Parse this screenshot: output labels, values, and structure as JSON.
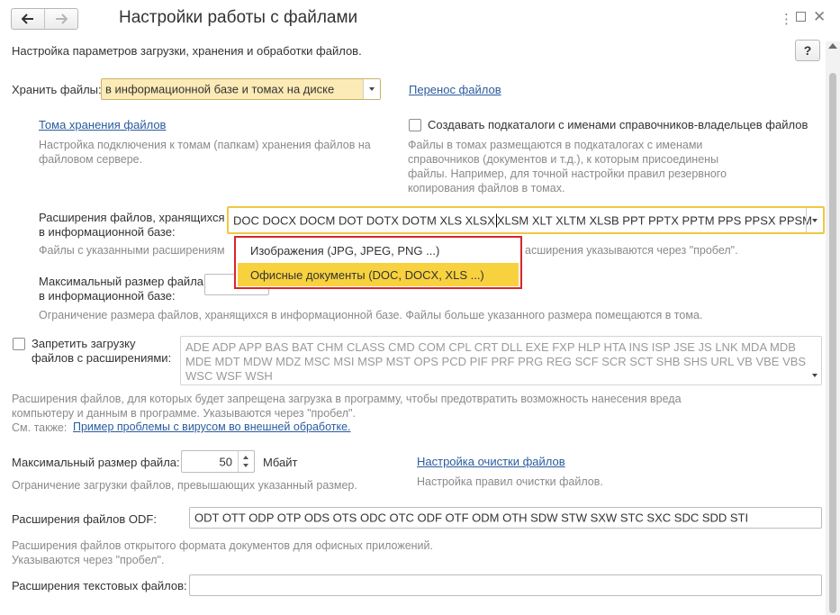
{
  "window": {
    "title": "Настройки работы с файлами",
    "subtitle": "Настройка параметров загрузки, хранения и обработки файлов.",
    "help_label": "?",
    "back_icon": "arrow-left-icon",
    "forward_icon": "arrow-right-icon",
    "menu_icon": "more-icon",
    "maximize_icon": "maximize-icon",
    "close_icon": "close-icon"
  },
  "storage": {
    "label": "Хранить файлы:",
    "value": "в информационной базе и томах на диске",
    "transfer_link": "Перенос файлов",
    "volumes_link": "Тома хранения файлов",
    "volumes_hint": "Настройка подключения к томам (папкам) хранения файлов на файловом сервере.",
    "subfolders_label": "Создавать подкаталоги с именами справочников-владельцев файлов",
    "subfolders_hint": "Файлы в томах размещаются в подкаталогах с именами справочников (документов и т.д.), к которым присоединены файлы. Например, для точной настройки правил резервного копирования файлов в томах."
  },
  "ib_extensions": {
    "label_line1": "Расширения файлов, хранящихся",
    "label_line2": "в информационной базе:",
    "value_before_cursor": "DOC DOCX DOCM DOT DOTX DOTM XLS XLSX",
    "value_after_cursor": "XLSM XLT XLTM XLSB PPT PPTX PPTM PPS PPSX PPSM",
    "hint_left": "Файлы с указанными расширениям",
    "hint_right": "асширения указываются через \"пробел\".",
    "dropdown_items": [
      "Изображения (JPG, JPEG, PNG ...)",
      "Офисные документы (DOC, DOCX, XLS ...)"
    ],
    "selected_index": 1
  },
  "ib_max_size": {
    "label_line1": "Максимальный размер файла",
    "label_line2": "в информационной базе:",
    "hint": "Ограничение размера файлов, хранящихся в информационной базе. Файлы больше указанного размера помещаются в тома."
  },
  "forbid": {
    "label_line1": "Запретить загрузку",
    "label_line2": "файлов с расширениями:",
    "value": "ADE ADP APP BAS BAT CHM CLASS CMD COM CPL CRT DLL EXE FXP HLP HTA INS ISP JSE JS LNK MDA MDB MDE MDT MDW MDZ MSC MSI MSP MST OPS PCD PIF PRF PRG REG SCF SCR SCT SHB SHS URL VB VBE VBS WSC WSF WSH",
    "hint_line1": "Расширения файлов, для которых будет запрещена загрузка в программу, чтобы предотвратить возможность нанесения вреда",
    "hint_line2": "компьютеру и данным в программе. Указываются через \"пробел\".",
    "see_also": "См. также:",
    "virus_link": "Пример проблемы с вирусом во внешней  обработке."
  },
  "max_size": {
    "label": "Максимальный размер файла:",
    "value": "50",
    "unit": "Мбайт",
    "hint": "Ограничение загрузки файлов, превышающих указанный размер.",
    "cleanup_link": "Настройка очистки файлов",
    "cleanup_hint": "Настройка правил очистки файлов."
  },
  "odf": {
    "label": "Расширения файлов ODF:",
    "value": "ODT OTT ODP OTP ODS OTS ODC OTC ODF OTF ODM OTH SDW STW SXW STC SXC SDC SDD STI",
    "hint_line1": "Расширения файлов открытого формата документов для офисных приложений.",
    "hint_line2": "Указываются через \"пробел\"."
  },
  "text_ext": {
    "label": "Расширения текстовых файлов:",
    "value": ""
  },
  "colors": {
    "accent": "#f8d13f",
    "highlight_border": "#d7262d",
    "focus_border": "#f0c744",
    "link": "#2a5b9e"
  }
}
